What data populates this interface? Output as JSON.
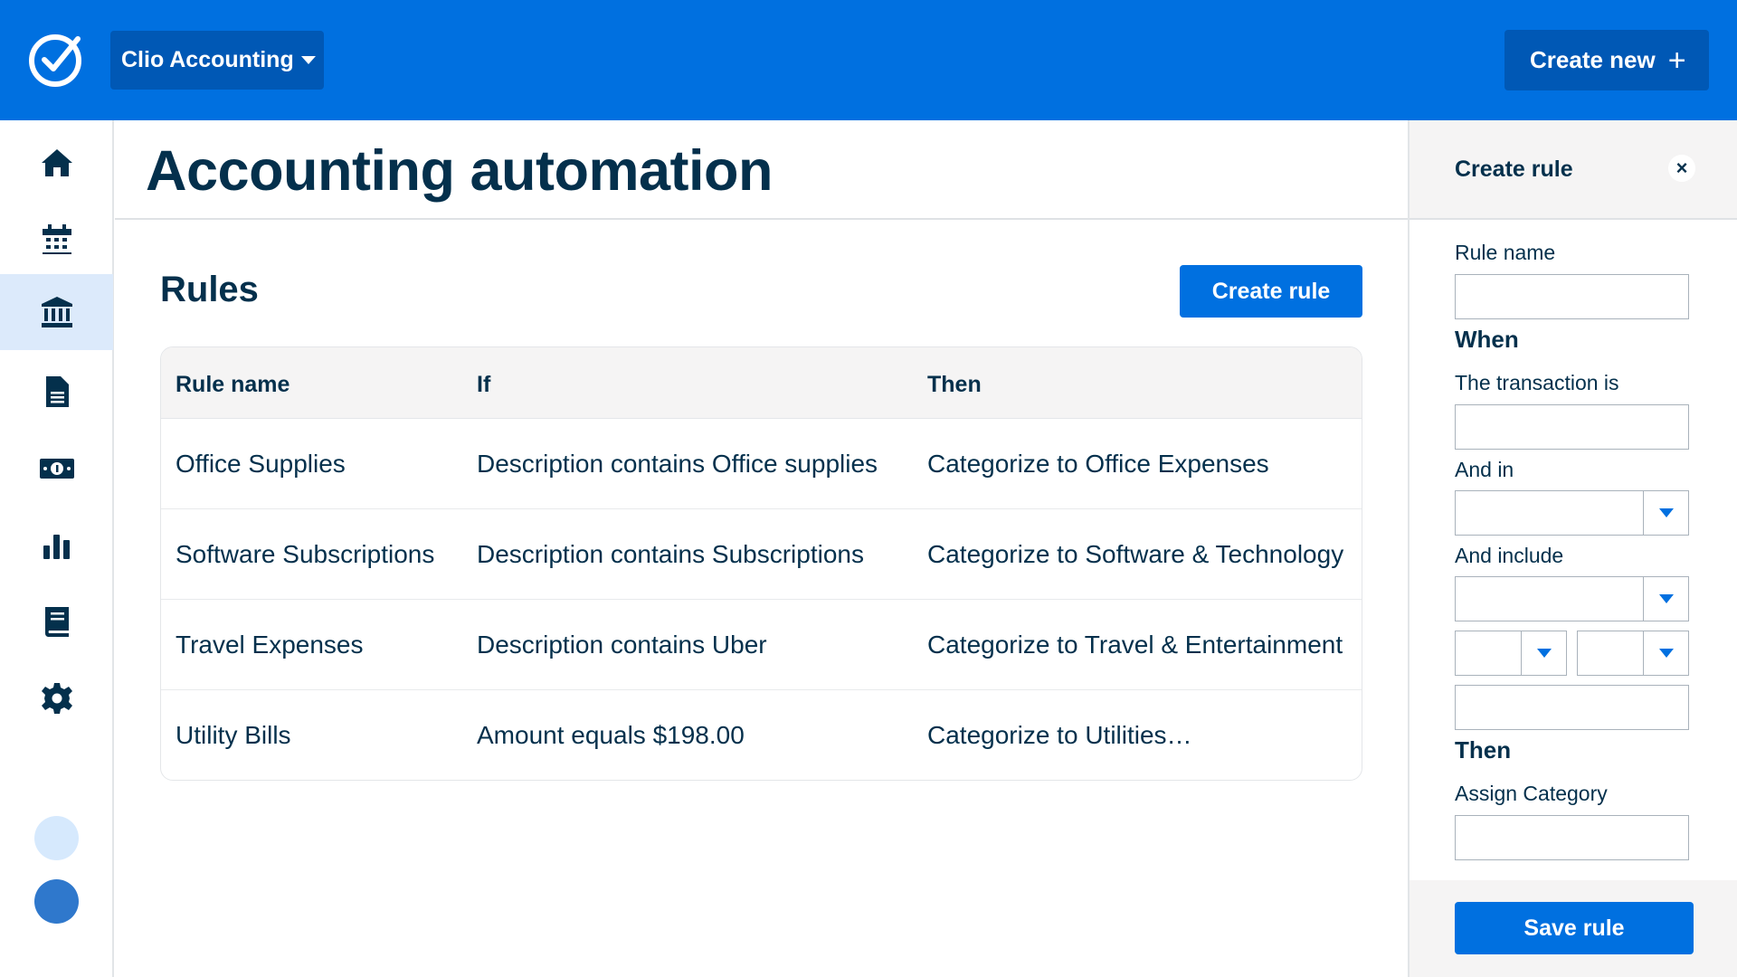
{
  "topbar": {
    "logo_icon": "check-badge-icon",
    "org_name": "Clio Accounting",
    "create_new_label": "Create new",
    "create_new_icon": "+"
  },
  "nav": {
    "items": [
      {
        "name": "home-icon"
      },
      {
        "name": "calendar-icon"
      },
      {
        "name": "bank-icon",
        "active": true
      },
      {
        "name": "document-icon"
      },
      {
        "name": "money-icon"
      },
      {
        "name": "reports-icon"
      },
      {
        "name": "book-icon"
      },
      {
        "name": "gear-icon"
      }
    ]
  },
  "page": {
    "title": "Accounting automation",
    "rules_heading": "Rules",
    "create_rule_label": "Create rule"
  },
  "table": {
    "headers": [
      "Rule name",
      "If",
      "Then"
    ],
    "rows": [
      [
        "Office Supplies",
        "Description contains Office supplies",
        "Categorize to Office Expenses"
      ],
      [
        "Software Subscriptions",
        "Description contains Subscriptions",
        "Categorize to Software & Technology"
      ],
      [
        "Travel Expenses",
        "Description contains Uber",
        "Categorize to Travel & Entertainment"
      ],
      [
        "Utility Bills",
        "Amount equals $198.00",
        "Categorize to Utilities…"
      ]
    ]
  },
  "panel": {
    "title": "Create rule",
    "close_icon": "×",
    "rule_name_label": "Rule name",
    "when_heading": "When",
    "transaction_label": "The transaction is",
    "and_in_label": "And in",
    "and_include_label": "And include",
    "then_heading": "Then",
    "assign_category_label": "Assign Category",
    "save_label": "Save rule"
  },
  "colors": {
    "brand_blue": "#0070e0",
    "dark_blue": "#0058b5",
    "text_navy": "#04304c",
    "active_nav_bg": "#dceafb"
  }
}
